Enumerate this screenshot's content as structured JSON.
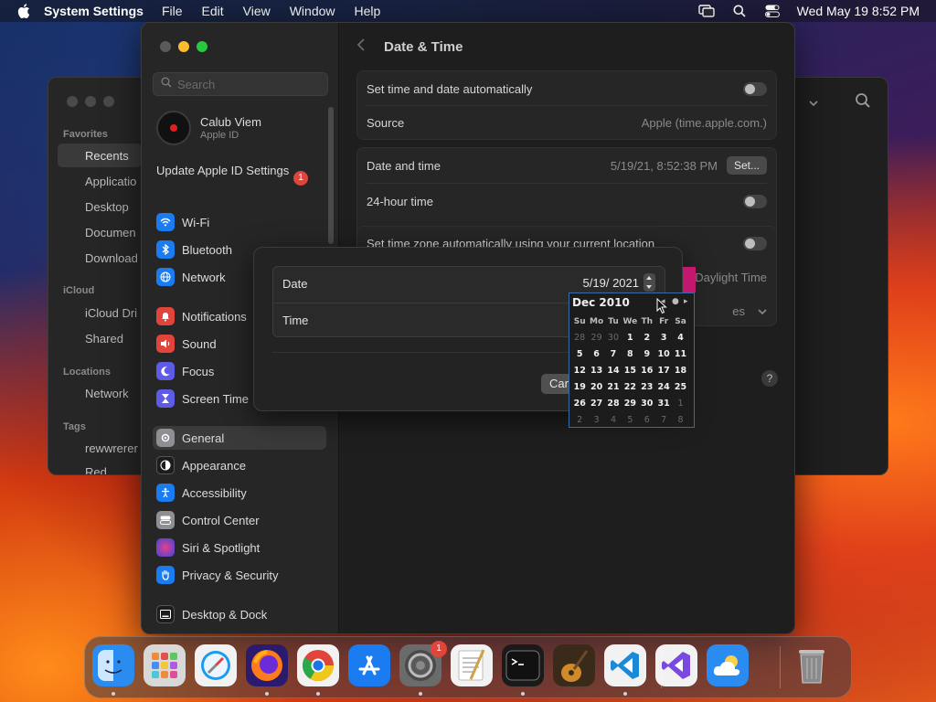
{
  "menubar": {
    "app_name": "System Settings",
    "menus": [
      "File",
      "Edit",
      "View",
      "Window",
      "Help"
    ],
    "datetime": "Wed May 19  8:52 PM"
  },
  "finder": {
    "sections": [
      "Favorites",
      "iCloud",
      "Locations",
      "Tags"
    ],
    "favorites": [
      "Recents",
      "Applicatio",
      "Desktop",
      "Documen",
      "Download"
    ],
    "icloud": [
      "iCloud Dri",
      "Shared"
    ],
    "locations": [
      "Network"
    ],
    "tags": [
      "rewwrerer",
      "Red"
    ]
  },
  "settings": {
    "search_placeholder": "Search",
    "account": {
      "name": "Calub Viem",
      "sub": "Apple ID"
    },
    "update_label": "Update Apple ID Settings",
    "update_badge": "1",
    "nav": [
      {
        "label": "Wi-Fi",
        "icon": "wifi-icon",
        "color": "#1a7cf0"
      },
      {
        "label": "Bluetooth",
        "icon": "bluetooth-icon",
        "color": "#1a7cf0"
      },
      {
        "label": "Network",
        "icon": "globe-icon",
        "color": "#1a7cf0"
      },
      {
        "label": "Notifications",
        "icon": "bell-icon",
        "color": "#e0443a"
      },
      {
        "label": "Sound",
        "icon": "speaker-icon",
        "color": "#e0443a"
      },
      {
        "label": "Focus",
        "icon": "moon-icon",
        "color": "#5e5ce6"
      },
      {
        "label": "Screen Time",
        "icon": "hourglass-icon",
        "color": "#5e5ce6"
      },
      {
        "label": "General",
        "icon": "gear-icon",
        "color": "#8e8e93"
      },
      {
        "label": "Appearance",
        "icon": "appearance-icon",
        "color": "#1c1c1c"
      },
      {
        "label": "Accessibility",
        "icon": "accessibility-icon",
        "color": "#1a7cf0"
      },
      {
        "label": "Control Center",
        "icon": "control-center-icon",
        "color": "#8e8e93"
      },
      {
        "label": "Siri & Spotlight",
        "icon": "siri-icon",
        "color": "#b0357a"
      },
      {
        "label": "Privacy & Security",
        "icon": "hand-icon",
        "color": "#1a7cf0"
      },
      {
        "label": "Desktop & Dock",
        "icon": "dock-icon",
        "color": "#1c1c1c"
      }
    ],
    "page_title": "Date & Time",
    "rows": {
      "auto_time": "Set time and date automatically",
      "source_label": "Source",
      "source_value": "Apple (time.apple.com.)",
      "date_time_label": "Date and time",
      "date_time_value": "5/19/21, 8:52:38 PM",
      "set_button": "Set...",
      "hour24": "24-hour time",
      "auto_tz": "Set time zone automatically using your current location",
      "tz_partial": "Daylight Time",
      "closest_partial": "es"
    },
    "help": "?"
  },
  "sheet": {
    "date_label": "Date",
    "date_value": "5/19/ 2021",
    "time_label": "Time",
    "cancel_label": "Cancel"
  },
  "calendar": {
    "month_label": "Dec 2010",
    "weekdays": [
      "Su",
      "Mo",
      "Tu",
      "We",
      "Th",
      "Fr",
      "Sa"
    ],
    "weeks": [
      [
        "28",
        "29",
        "30",
        "1",
        "2",
        "3",
        "4"
      ],
      [
        "5",
        "6",
        "7",
        "8",
        "9",
        "10",
        "11"
      ],
      [
        "12",
        "13",
        "14",
        "15",
        "16",
        "17",
        "18"
      ],
      [
        "19",
        "20",
        "21",
        "22",
        "23",
        "24",
        "25"
      ],
      [
        "26",
        "27",
        "28",
        "29",
        "30",
        "31",
        "1"
      ],
      [
        "2",
        "3",
        "4",
        "5",
        "6",
        "7",
        "8"
      ]
    ],
    "out_of_month": [
      [
        true,
        true,
        true,
        false,
        false,
        false,
        false
      ],
      [
        false,
        false,
        false,
        false,
        false,
        false,
        false
      ],
      [
        false,
        false,
        false,
        false,
        false,
        false,
        false
      ],
      [
        false,
        false,
        false,
        false,
        false,
        false,
        false
      ],
      [
        false,
        false,
        false,
        false,
        false,
        false,
        true
      ],
      [
        true,
        true,
        true,
        true,
        true,
        true,
        true
      ]
    ]
  },
  "dock": {
    "apps": [
      {
        "name": "finder-icon",
        "color": "#2a8cf0",
        "running": true
      },
      {
        "name": "launchpad-icon",
        "color": "#d8d8d8",
        "running": false
      },
      {
        "name": "safari-icon",
        "color": "#f2f2f2",
        "running": false
      },
      {
        "name": "firefox-icon",
        "color": "#2a1b6e",
        "running": true
      },
      {
        "name": "chrome-icon",
        "color": "#f2f2f2",
        "running": true
      },
      {
        "name": "app-store-icon",
        "color": "#1a7cf0",
        "running": false
      },
      {
        "name": "system-settings-icon",
        "color": "#6b6b6b",
        "running": true,
        "badge": "1"
      },
      {
        "name": "textedit-icon",
        "color": "#f2f2f2",
        "running": false
      },
      {
        "name": "terminal-icon",
        "color": "#1a1a1a",
        "running": true
      },
      {
        "name": "garageband-icon",
        "color": "#3a2a1a",
        "running": false
      },
      {
        "name": "vscode-icon",
        "color": "#f2f2f2",
        "running": true
      },
      {
        "name": "visual-studio-icon",
        "color": "#f2f2f2",
        "running": false
      },
      {
        "name": "weather-icon",
        "color": "#2a8cf0",
        "running": false
      },
      {
        "name": "trash-icon",
        "color": "transparent",
        "running": false
      }
    ]
  }
}
